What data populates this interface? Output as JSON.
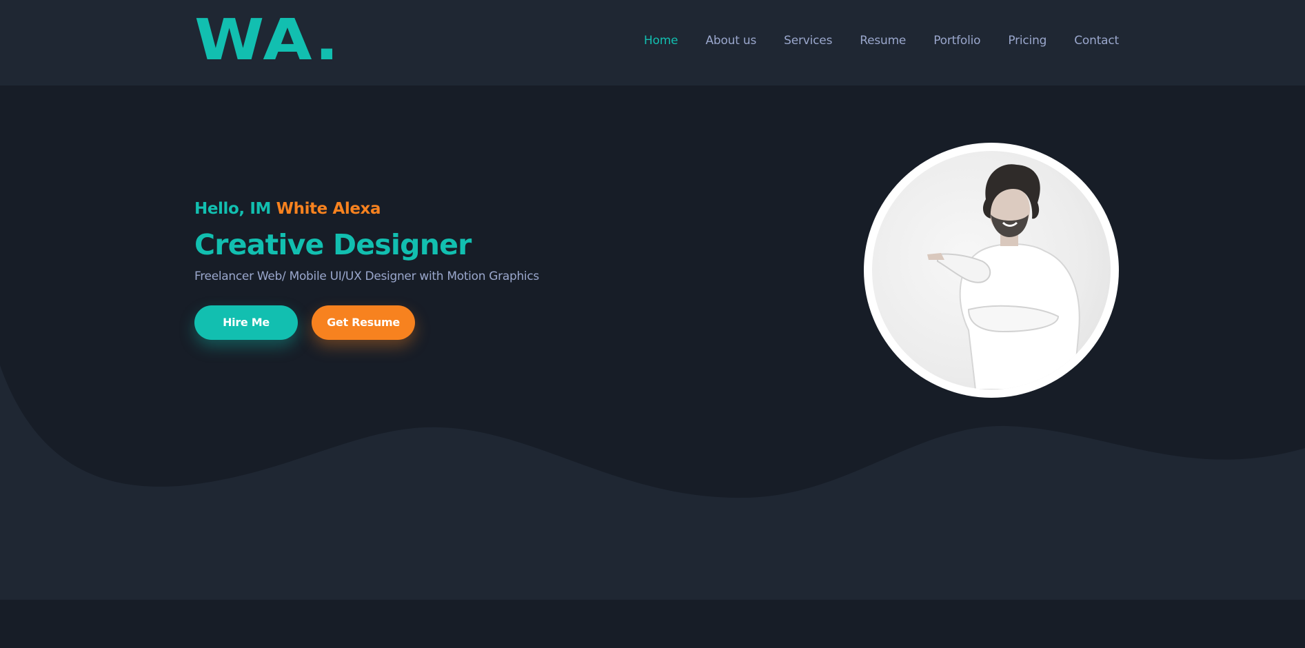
{
  "brand": {
    "logo_text": "WA",
    "logo_dot": "."
  },
  "nav": {
    "items": [
      {
        "label": "Home",
        "active": true
      },
      {
        "label": "About us",
        "active": false
      },
      {
        "label": "Services",
        "active": false
      },
      {
        "label": "Resume",
        "active": false
      },
      {
        "label": "Portfolio",
        "active": false
      },
      {
        "label": "Pricing",
        "active": false
      },
      {
        "label": "Contact",
        "active": false
      }
    ]
  },
  "hero": {
    "greeting_prefix": "Hello, IM",
    "greeting_name": "White Alexa",
    "title": "Creative Designer",
    "subtitle": "Freelancer Web/ Mobile UI/UX Designer with Motion Graphics",
    "hire_button": "Hire Me",
    "resume_button": "Get Resume"
  },
  "avatar": {
    "icon": "profile-photo"
  },
  "colors": {
    "accent": "#12bfb0",
    "secondary": "#f7821f",
    "header_bg": "#1f2733",
    "page_bg": "#171d27",
    "nav_text": "#9aa7cc"
  }
}
